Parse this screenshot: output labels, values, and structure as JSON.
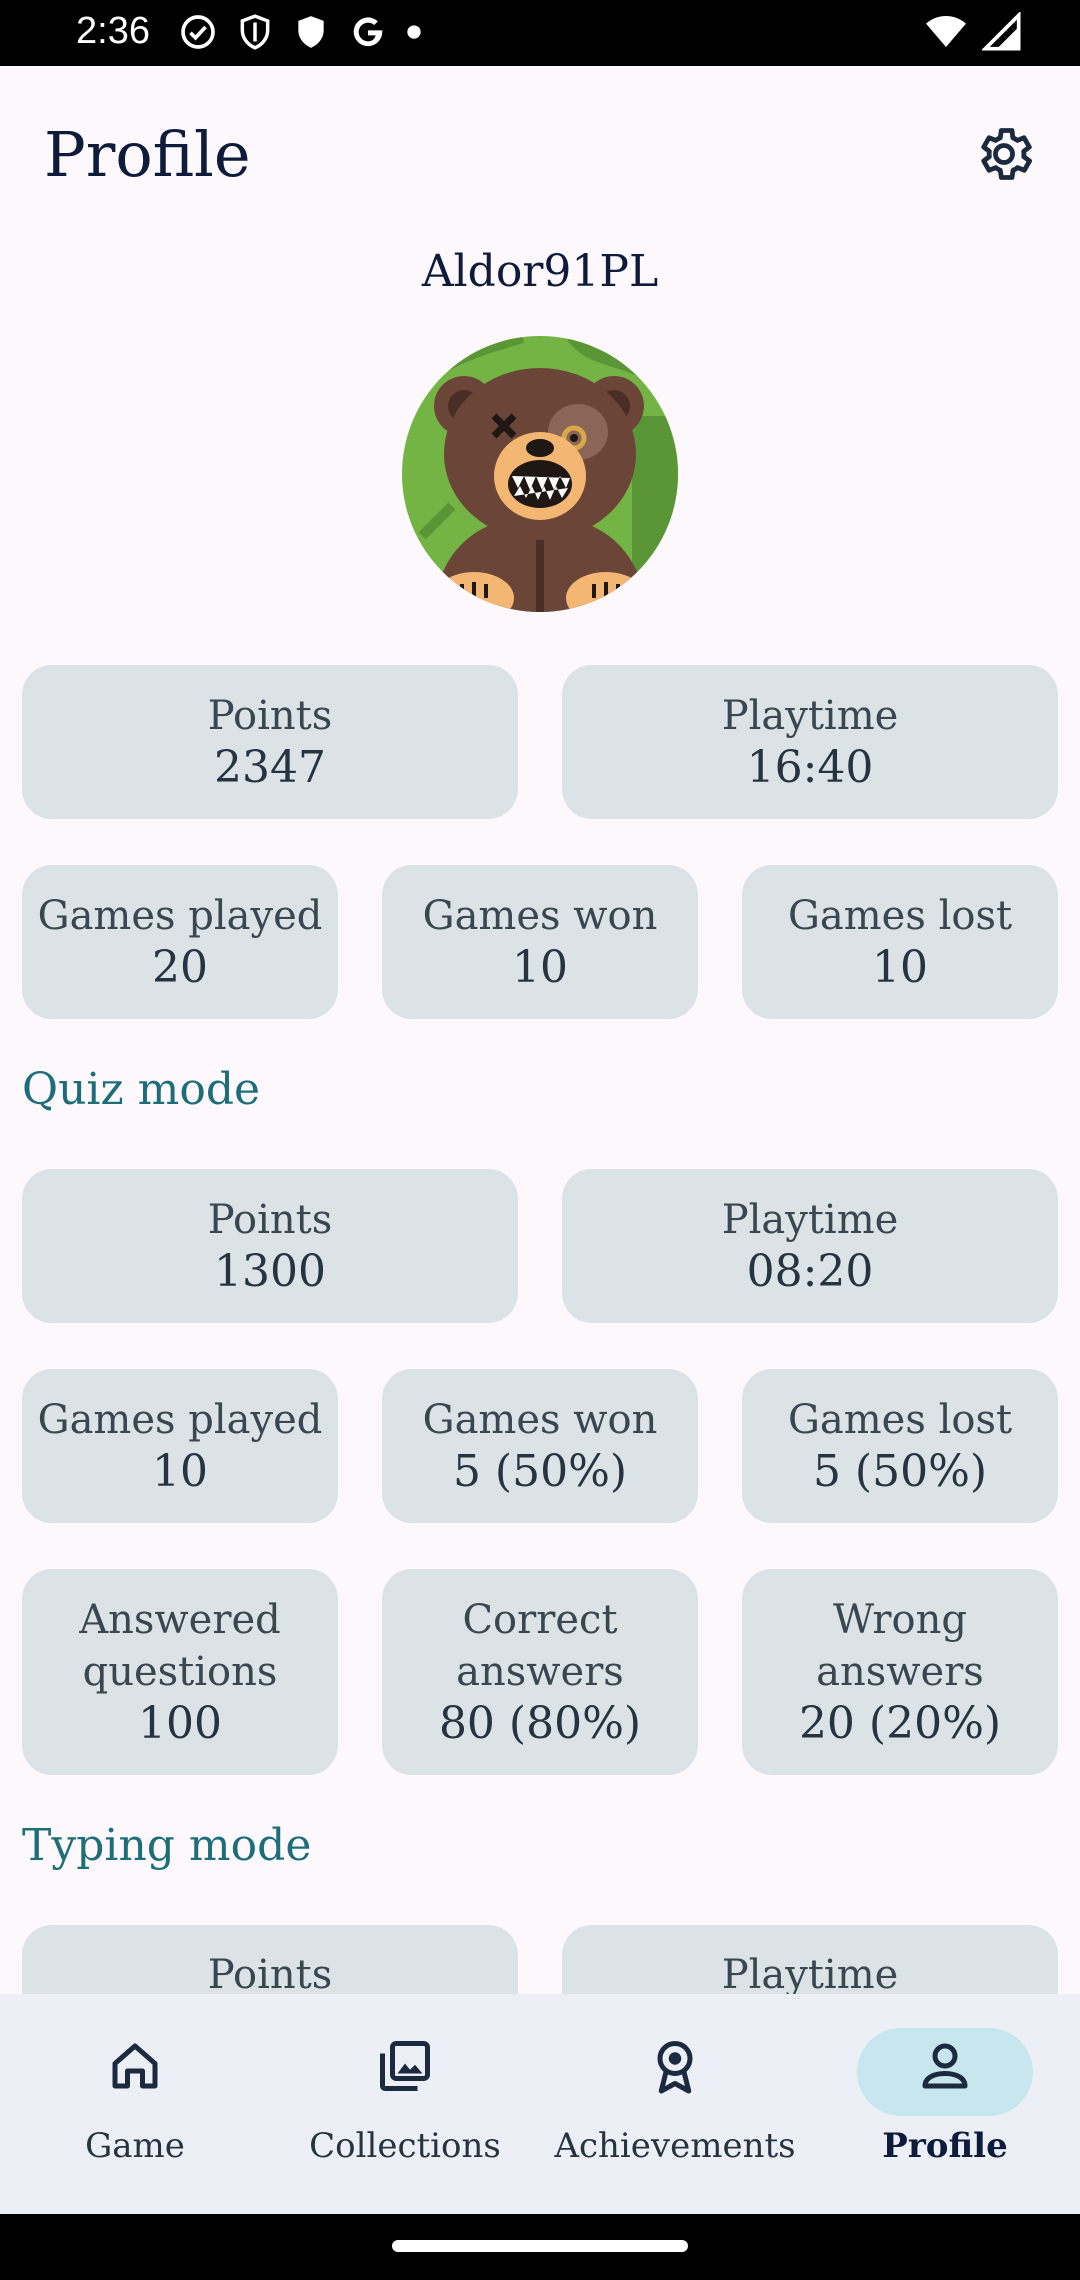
{
  "status": {
    "time": "2:36"
  },
  "header": {
    "title": "Profile"
  },
  "profile": {
    "username": "Aldor91PL"
  },
  "overall": {
    "points_label": "Points",
    "points_value": "2347",
    "playtime_label": "Playtime",
    "playtime_value": "16:40",
    "played_label": "Games played",
    "played_value": "20",
    "won_label": "Games won",
    "won_value": "10",
    "lost_label": "Games lost",
    "lost_value": "10"
  },
  "quiz": {
    "title": "Quiz mode",
    "points_label": "Points",
    "points_value": "1300",
    "playtime_label": "Playtime",
    "playtime_value": "08:20",
    "played_label": "Games played",
    "played_value": "10",
    "won_label": "Games won",
    "won_value": "5 (50%)",
    "lost_label": "Games lost",
    "lost_value": "5 (50%)",
    "answered_label_1": "Answered",
    "answered_label_2": "questions",
    "answered_value": "100",
    "correct_label_1": "Correct",
    "correct_label_2": "answers",
    "correct_value": "80 (80%)",
    "wrong_label_1": "Wrong",
    "wrong_label_2": "answers",
    "wrong_value": "20 (20%)"
  },
  "typing": {
    "title": "Typing mode",
    "points_label": "Points",
    "playtime_label": "Playtime"
  },
  "nav": {
    "items": [
      {
        "label": "Game",
        "icon": "home-icon"
      },
      {
        "label": "Collections",
        "icon": "collections-icon"
      },
      {
        "label": "Achievements",
        "icon": "award-icon"
      },
      {
        "label": "Profile",
        "icon": "person-icon"
      }
    ],
    "active": "Profile"
  },
  "colors": {
    "background": "#fcf8fc",
    "card": "#dbe3e6",
    "section_title": "#1e6e7a",
    "nav_background": "#eceff6",
    "nav_active_pill": "#c8e6ee"
  }
}
